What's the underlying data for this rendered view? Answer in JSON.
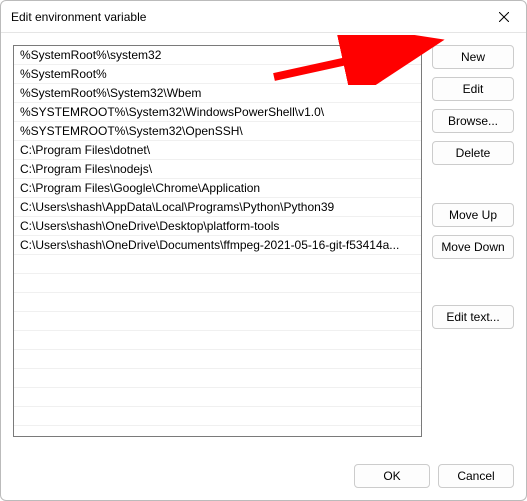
{
  "window": {
    "title": "Edit environment variable"
  },
  "list": {
    "items": [
      "%SystemRoot%\\system32",
      "%SystemRoot%",
      "%SystemRoot%\\System32\\Wbem",
      "%SYSTEMROOT%\\System32\\WindowsPowerShell\\v1.0\\",
      "%SYSTEMROOT%\\System32\\OpenSSH\\",
      "C:\\Program Files\\dotnet\\",
      "C:\\Program Files\\nodejs\\",
      "C:\\Program Files\\Google\\Chrome\\Application",
      "C:\\Users\\shash\\AppData\\Local\\Programs\\Python\\Python39",
      "C:\\Users\\shash\\OneDrive\\Desktop\\platform-tools",
      "C:\\Users\\shash\\OneDrive\\Documents\\ffmpeg-2021-05-16-git-f53414a..."
    ]
  },
  "buttons": {
    "new": "New",
    "edit": "Edit",
    "browse": "Browse...",
    "delete": "Delete",
    "moveUp": "Move Up",
    "moveDown": "Move Down",
    "editText": "Edit text...",
    "ok": "OK",
    "cancel": "Cancel"
  }
}
